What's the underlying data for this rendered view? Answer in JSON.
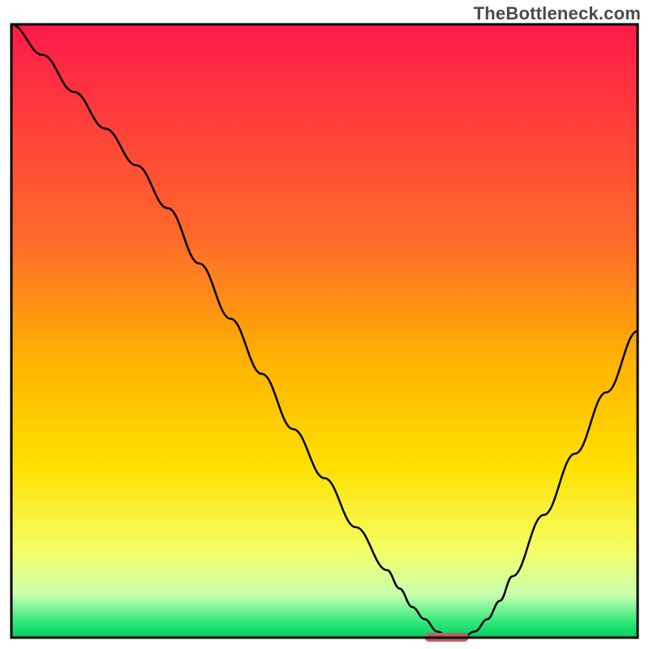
{
  "watermark": "TheBottleneck.com",
  "chart_data": {
    "type": "line",
    "title": "",
    "xlabel": "",
    "ylabel": "",
    "xlim": [
      0,
      100
    ],
    "ylim": [
      0,
      100
    ],
    "x": [
      0,
      5,
      10,
      15,
      20,
      25,
      30,
      35,
      40,
      45,
      50,
      55,
      60,
      62,
      64,
      66,
      68,
      70,
      72,
      74,
      76,
      78,
      80,
      85,
      90,
      95,
      100
    ],
    "values": [
      100,
      95,
      89,
      83,
      77,
      70,
      61,
      52,
      43,
      34,
      26,
      18,
      11,
      8,
      5,
      3,
      1,
      0,
      0,
      1,
      3,
      6,
      10,
      20,
      30,
      40,
      50
    ],
    "marker_x_range": [
      66,
      73
    ],
    "marker_y": 0,
    "gradient_stops": [
      {
        "offset": 0.0,
        "color": "#ff1a4a"
      },
      {
        "offset": 0.35,
        "color": "#ff6a2a"
      },
      {
        "offset": 0.55,
        "color": "#ffb300"
      },
      {
        "offset": 0.72,
        "color": "#ffe000"
      },
      {
        "offset": 0.86,
        "color": "#f4ff66"
      },
      {
        "offset": 0.93,
        "color": "#c8ffb0"
      },
      {
        "offset": 0.975,
        "color": "#2fe87a"
      },
      {
        "offset": 1.0,
        "color": "#00d060"
      }
    ],
    "marker_color": "#cc5a66",
    "curve_color": "#000000",
    "frame_color": "#000000"
  }
}
